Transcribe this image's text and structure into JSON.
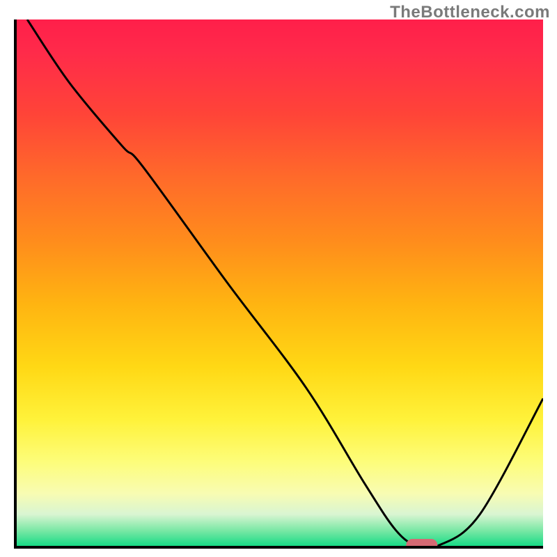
{
  "watermark": "TheBottleneck.com",
  "colors": {
    "axis": "#000000",
    "curve": "#000000",
    "marker": "#d56a74",
    "watermark": "#7a7a7a"
  },
  "chart_data": {
    "type": "line",
    "title": "",
    "xlabel": "",
    "ylabel": "",
    "xlim": [
      0,
      100
    ],
    "ylim": [
      0,
      100
    ],
    "legend": false,
    "grid": false,
    "annotations": [],
    "background": "rainbow-vertical-gradient (red top to green bottom)",
    "series": [
      {
        "name": "curve",
        "x": [
          2,
          10,
          20,
          24,
          40,
          55,
          66,
          72,
          76,
          80,
          88,
          100
        ],
        "values": [
          100,
          88,
          76,
          72,
          50,
          30,
          12,
          3,
          0,
          0,
          6,
          28
        ]
      }
    ],
    "marker": {
      "x_center": 77,
      "width": 6,
      "y": 0
    }
  }
}
